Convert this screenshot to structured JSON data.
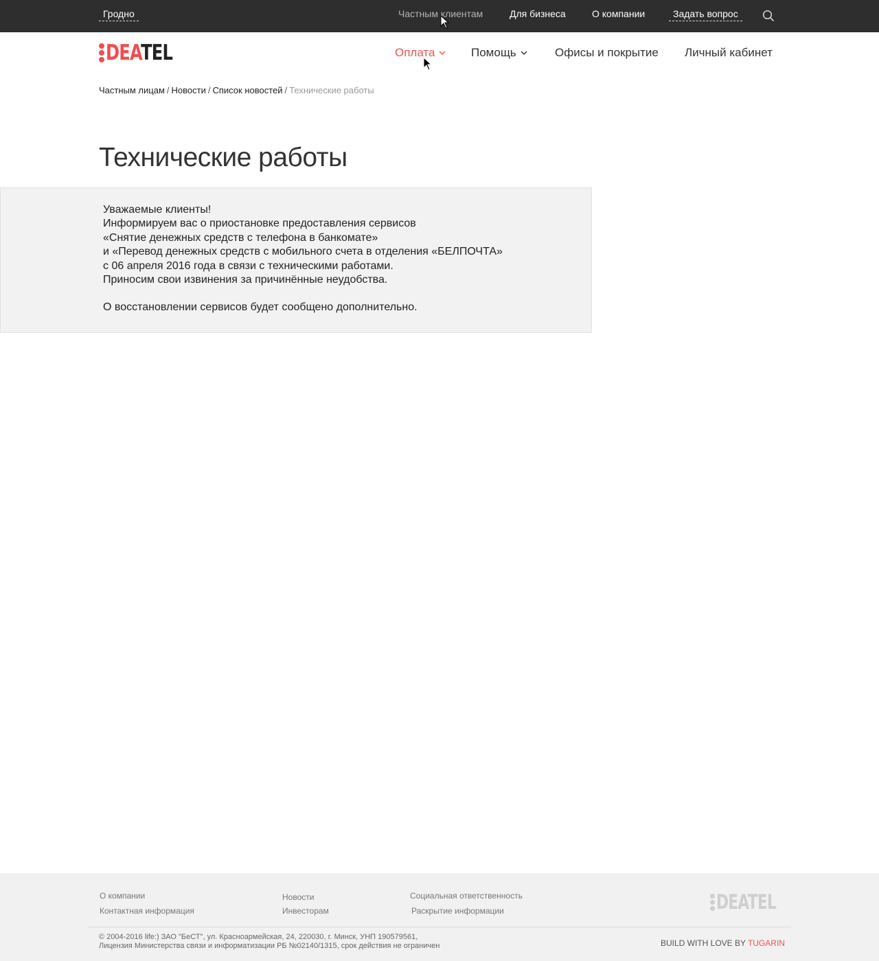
{
  "topbar": {
    "city": "Гродно",
    "nav": [
      "Частным клиентам",
      "Для бизнеса",
      "О компании"
    ],
    "ask": "Задать вопрос"
  },
  "logo": {
    "part1": "DEA",
    "part2": "TEL"
  },
  "main_nav": [
    "Оплата",
    "Помощь",
    "Офисы и покрытие",
    "Личный кабинет"
  ],
  "breadcrumb": [
    "Частным лицам",
    "Новости",
    "Список новостей",
    "Технические работы"
  ],
  "page_title": "Технические работы",
  "notice": {
    "lines": [
      "Уважаемые клиенты!",
      "Информируем вас о приостановке предоставления сервисов",
      "«Снятие денежных средств с телефона в банкомате»",
      "и «Перевод денежных средств с мобильного счета в отделения «БЕЛПОЧТА»",
      "с 06 апреля 2016 года в связи с техническими работами.",
      "Приносим свои извинения за причинённые неудобства."
    ],
    "footer_line": "О восстановлении сервисов будет сообщено дополнительно."
  },
  "footer": {
    "col1": [
      "О компании",
      "Контактная информация"
    ],
    "col2": [
      "Новости",
      "Инвесторам"
    ],
    "col3": [
      "Социальная ответственность",
      "Раскрытие информации"
    ],
    "copyright1": "© 2004-2016 life:) ЗАО \"БеСТ\", ул. Красноармейская, 24, 220030, г. Минск, УНП 190579561,",
    "copyright2": "Лицензия Министерства связи и информатизации РБ №02140/1315, срок действия не ограничен",
    "build_prefix": "BUILD WITH LOVE BY",
    "build_brand": "TUGARIN",
    "logo_text": "DEATEL"
  },
  "colors": {
    "accent": "#f05252",
    "topbar_bg": "#2e2e2e",
    "notice_bg": "#f2f2f2",
    "footer_bg": "#f1f1f1"
  }
}
